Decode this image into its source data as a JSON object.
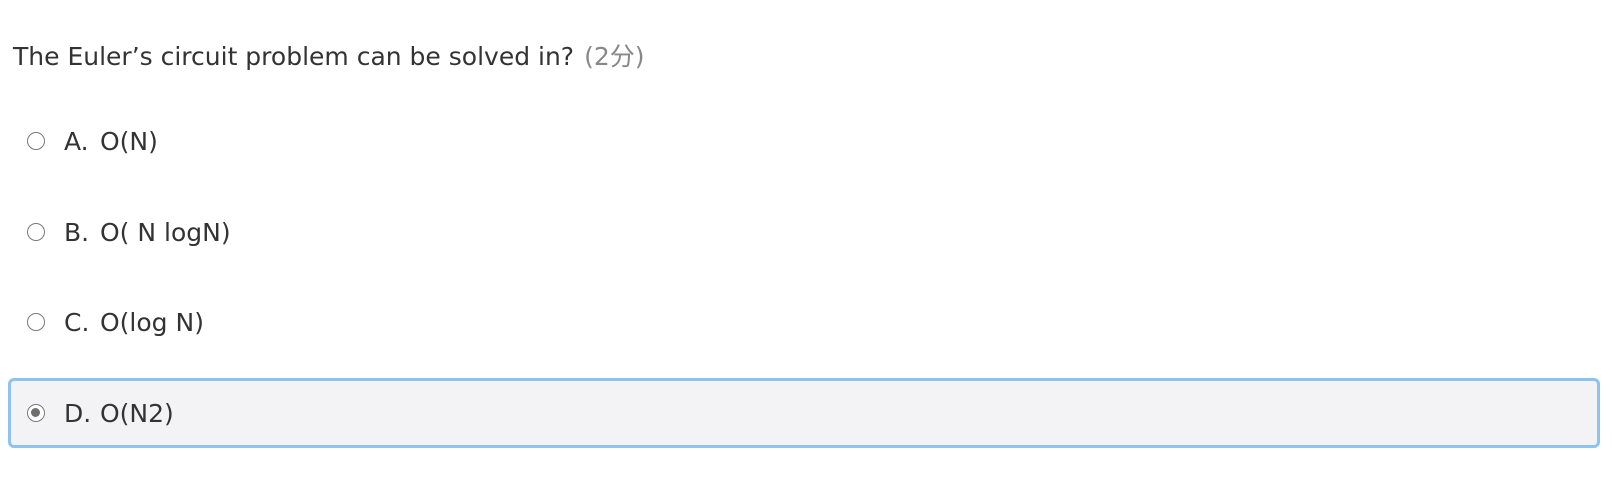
{
  "question": {
    "text": "The Euler’s circuit problem can be solved in?",
    "points": "(2分)"
  },
  "options": [
    {
      "letter": "A.",
      "text": "O(N)",
      "selected": false
    },
    {
      "letter": "B.",
      "text": "O( N logN)",
      "selected": false
    },
    {
      "letter": "C.",
      "text": "O(log N)",
      "selected": false
    },
    {
      "letter": "D.",
      "text": "O(N2)",
      "selected": true
    }
  ],
  "colors": {
    "selected_border": "#8ec2ef",
    "selected_background": "#f3f3f5"
  }
}
